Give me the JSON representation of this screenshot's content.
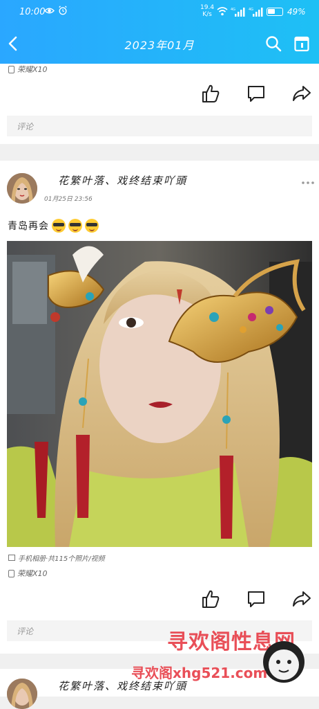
{
  "status_bar": {
    "time": "10:00",
    "network_speed_value": "19.4",
    "network_speed_unit": "K/s",
    "signal1_label": "4G",
    "signal2_label": "4G",
    "battery_percent": "49%"
  },
  "nav": {
    "title": "2023年01月"
  },
  "posts": [
    {
      "device": "荣耀X10",
      "comment_placeholder": "评论"
    },
    {
      "username": "花繁叶落、戏终结束吖頭",
      "time": "01月25日 23:56",
      "text": "青岛再会",
      "emoji_count": 3,
      "album": "手机相册·共115个照片/视频",
      "device": "荣耀X10",
      "comment_placeholder": "评论"
    },
    {
      "username": "花繁叶落、戏终结束吖頭"
    }
  ],
  "watermark": {
    "line1": "寻欢阁性息网",
    "line2": "寻欢阁xhg521.com"
  },
  "colors": {
    "header_start": "#2aa7ff",
    "header_end": "#1ec0f5",
    "watermark": "#e8414a"
  }
}
